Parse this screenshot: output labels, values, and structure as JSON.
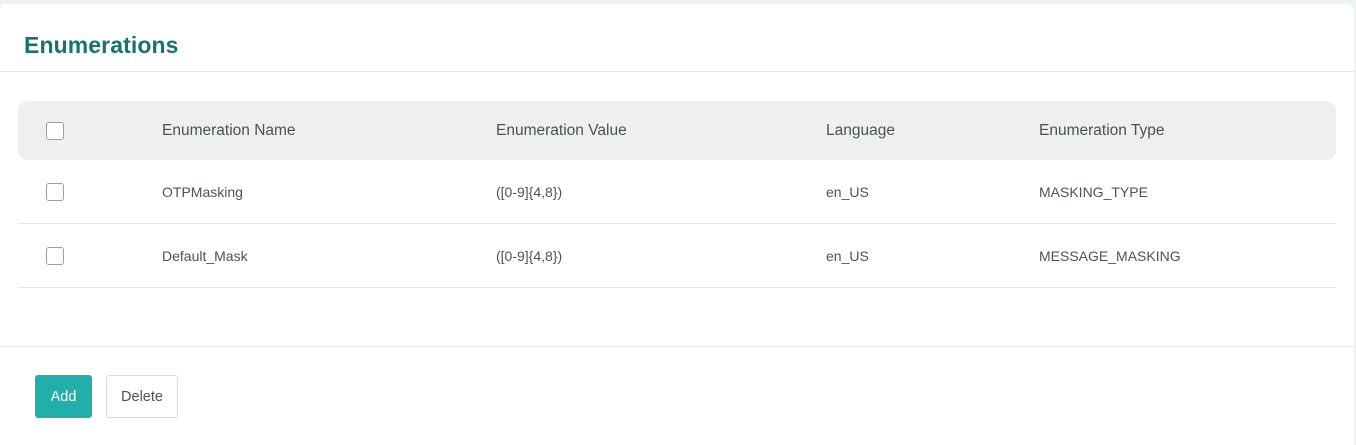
{
  "page": {
    "title": "Enumerations"
  },
  "table": {
    "columns": {
      "name": "Enumeration Name",
      "value": "Enumeration Value",
      "language": "Language",
      "type": "Enumeration Type"
    },
    "rows": [
      {
        "name": "OTPMasking",
        "value": "([0-9]{4,8})",
        "language": "en_US",
        "type": "MASKING_TYPE",
        "checked": false
      },
      {
        "name": "Default_Mask",
        "value": "([0-9]{4,8})",
        "language": "en_US",
        "type": "MESSAGE_MASKING",
        "checked": false
      }
    ]
  },
  "actions": {
    "add_label": "Add",
    "delete_label": "Delete"
  },
  "colors": {
    "title": "#17736b",
    "link": "#2aa3a0",
    "primary_button": "#24aeaa",
    "header_background": "#eef0ef"
  }
}
